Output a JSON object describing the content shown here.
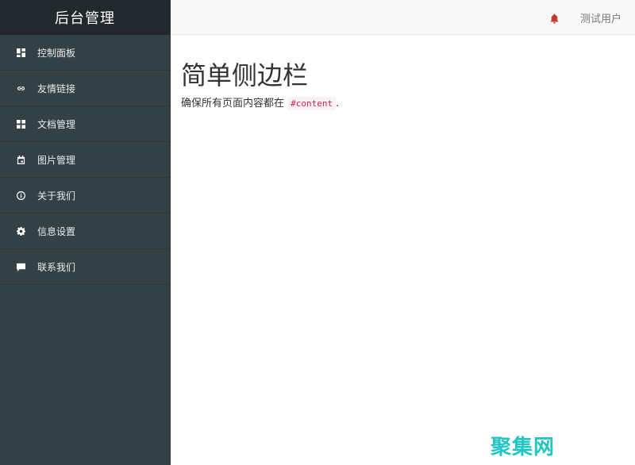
{
  "sidebar": {
    "title": "后台管理",
    "items": [
      {
        "label": "控制面板",
        "icon": "dashboard-icon"
      },
      {
        "label": "友情链接",
        "icon": "link-icon"
      },
      {
        "label": "文档管理",
        "icon": "grid-icon"
      },
      {
        "label": "图片管理",
        "icon": "calendar-icon"
      },
      {
        "label": "关于我们",
        "icon": "info-icon"
      },
      {
        "label": "信息设置",
        "icon": "gear-icon"
      },
      {
        "label": "联系我们",
        "icon": "chat-icon"
      }
    ]
  },
  "topbar": {
    "bell_icon": "bell-icon",
    "user_name": "测试用户"
  },
  "main": {
    "title": "简单侧边栏",
    "desc_prefix": "确保所有页面内容都在",
    "desc_code": "#content",
    "desc_suffix": "."
  },
  "watermark": {
    "text": "聚集网"
  },
  "colors": {
    "sidebar_bg": "#334146",
    "sidebar_header_bg": "#22292d",
    "topbar_bg": "#f8f8f8",
    "bell": "#c0392b",
    "code_text": "#c7254e",
    "watermark": "#21c5c4"
  }
}
